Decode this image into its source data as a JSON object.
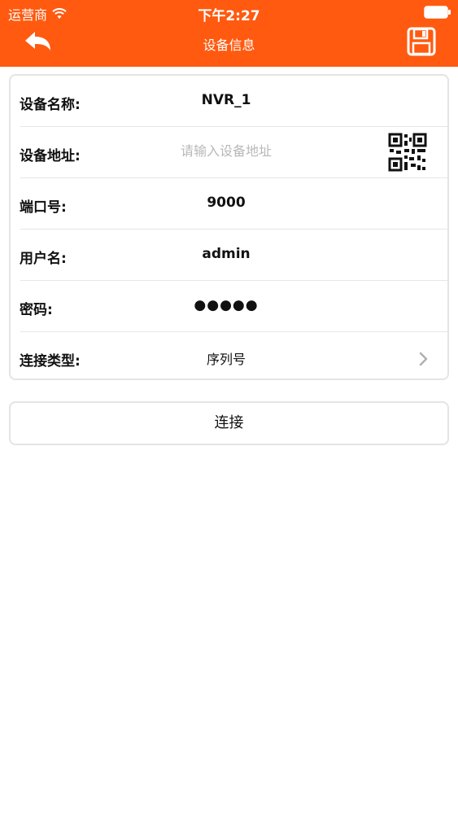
{
  "status_bar": {
    "carrier": "运营商",
    "time": "下午2:27",
    "wifi_icon": "wifi-icon",
    "battery_icon": "battery-icon"
  },
  "nav": {
    "title": "设备信息",
    "back_icon": "back-arrow-icon",
    "save_icon": "floppy-disk-save-icon",
    "bar_color": "#ff5a10"
  },
  "form": {
    "device_name": {
      "label": "设备名称:",
      "value": "NVR_1"
    },
    "device_address": {
      "label": "设备地址:",
      "value": "",
      "placeholder": "请输入设备地址",
      "scan_icon": "qr-code-icon"
    },
    "port": {
      "label": "端口号:",
      "value": "9000"
    },
    "username": {
      "label": "用户名:",
      "value": "admin"
    },
    "password": {
      "label": "密码:",
      "value": "●●●●●"
    },
    "connection_type": {
      "label": "连接类型:",
      "value": "序列号",
      "chevron_icon": "chevron-right-icon"
    }
  },
  "connect_button": {
    "label": "连接"
  }
}
